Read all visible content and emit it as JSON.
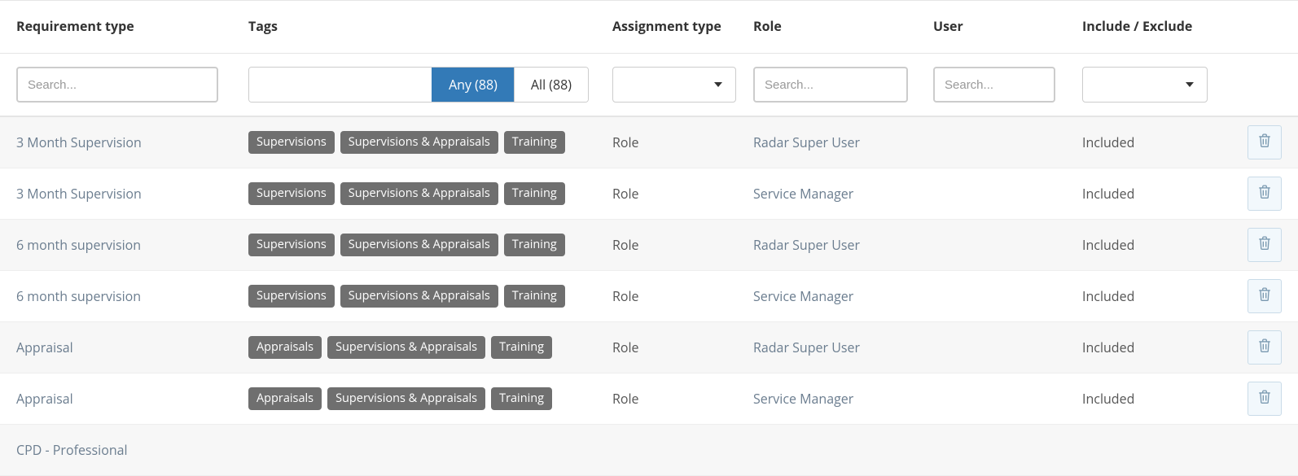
{
  "columns": {
    "requirement_type": "Requirement type",
    "tags": "Tags",
    "assignment_type": "Assignment type",
    "role": "Role",
    "user": "User",
    "include_exclude": "Include / Exclude"
  },
  "filters": {
    "search_placeholder": "Search...",
    "tag_any_label": "Any (88)",
    "tag_all_label": "All (88)"
  },
  "rows": [
    {
      "requirement": "3 Month Supervision",
      "tags": [
        "Supervisions",
        "Supervisions & Appraisals",
        "Training"
      ],
      "assignment_type": "Role",
      "role": "Radar Super User",
      "user": "",
      "include": "Included"
    },
    {
      "requirement": "3 Month Supervision",
      "tags": [
        "Supervisions",
        "Supervisions & Appraisals",
        "Training"
      ],
      "assignment_type": "Role",
      "role": "Service Manager",
      "user": "",
      "include": "Included"
    },
    {
      "requirement": "6 month supervision",
      "tags": [
        "Supervisions",
        "Supervisions & Appraisals",
        "Training"
      ],
      "assignment_type": "Role",
      "role": "Radar Super User",
      "user": "",
      "include": "Included"
    },
    {
      "requirement": "6 month supervision",
      "tags": [
        "Supervisions",
        "Supervisions & Appraisals",
        "Training"
      ],
      "assignment_type": "Role",
      "role": "Service Manager",
      "user": "",
      "include": "Included"
    },
    {
      "requirement": "Appraisal",
      "tags": [
        "Appraisals",
        "Supervisions & Appraisals",
        "Training"
      ],
      "assignment_type": "Role",
      "role": "Radar Super User",
      "user": "",
      "include": "Included"
    },
    {
      "requirement": "Appraisal",
      "tags": [
        "Appraisals",
        "Supervisions & Appraisals",
        "Training"
      ],
      "assignment_type": "Role",
      "role": "Service Manager",
      "user": "",
      "include": "Included"
    },
    {
      "requirement": "CPD - Professional",
      "tags": [],
      "assignment_type": "",
      "role": "",
      "user": "",
      "include": ""
    }
  ]
}
